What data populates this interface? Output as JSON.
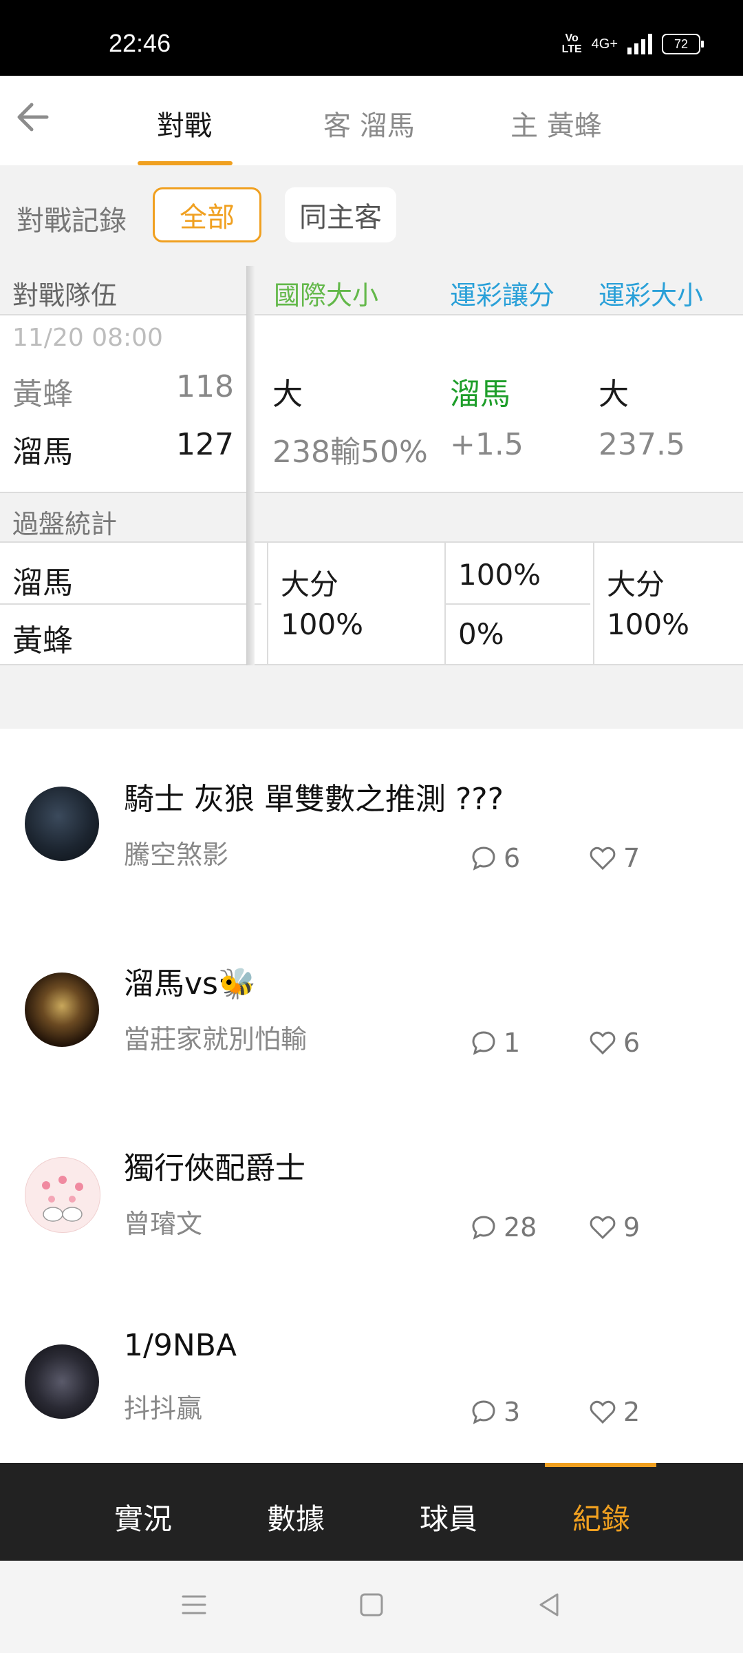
{
  "status": {
    "time": "22:46",
    "volte": "Vo\nLTE",
    "network": "4G+",
    "battery": "72"
  },
  "topbar": {
    "tabs": [
      "對戰",
      "客 溜馬",
      "主 黃蜂"
    ]
  },
  "filter": {
    "label": "對戰記錄",
    "chip_all": "全部",
    "chip_same": "同主客"
  },
  "table": {
    "headers": {
      "team": "對戰隊伍",
      "intl_total": "國際大小",
      "spread": "運彩讓分",
      "lottery_total": "運彩大小"
    },
    "match": {
      "datetime": "11/20 08:00",
      "rows": [
        {
          "team": "黃蜂",
          "score": "118",
          "intl": "大",
          "spread": "溜馬",
          "total": "大"
        },
        {
          "team": "溜馬",
          "score": "127",
          "intl": "238輸50%",
          "spread": "+1.5",
          "total": "237.5"
        }
      ]
    },
    "stats": {
      "title": "過盤統計",
      "teams": [
        "溜馬",
        "黃蜂"
      ],
      "intl": "大分\n100%",
      "spread_top": "100%",
      "spread_bottom": "0%",
      "total": "大分\n100%"
    }
  },
  "posts": [
    {
      "title": "騎士 灰狼 單雙數之推測 ???",
      "author": "騰空煞影",
      "comments": "6",
      "likes": "7"
    },
    {
      "title": "溜馬vs🐝",
      "author": "當莊家就別怕輸",
      "comments": "1",
      "likes": "6"
    },
    {
      "title": "獨行俠配爵士",
      "author": "曾璿文",
      "comments": "28",
      "likes": "9"
    },
    {
      "title": "1/9NBA",
      "author": "抖抖贏",
      "comments": "3",
      "likes": "2"
    }
  ],
  "bottomnav": {
    "tabs": [
      "實況",
      "數據",
      "球員",
      "紀錄"
    ]
  },
  "colors": {
    "accent": "#f0a020",
    "green": "#1e9e2a",
    "blue": "#2aa0d8",
    "light_green": "#63b84a"
  }
}
